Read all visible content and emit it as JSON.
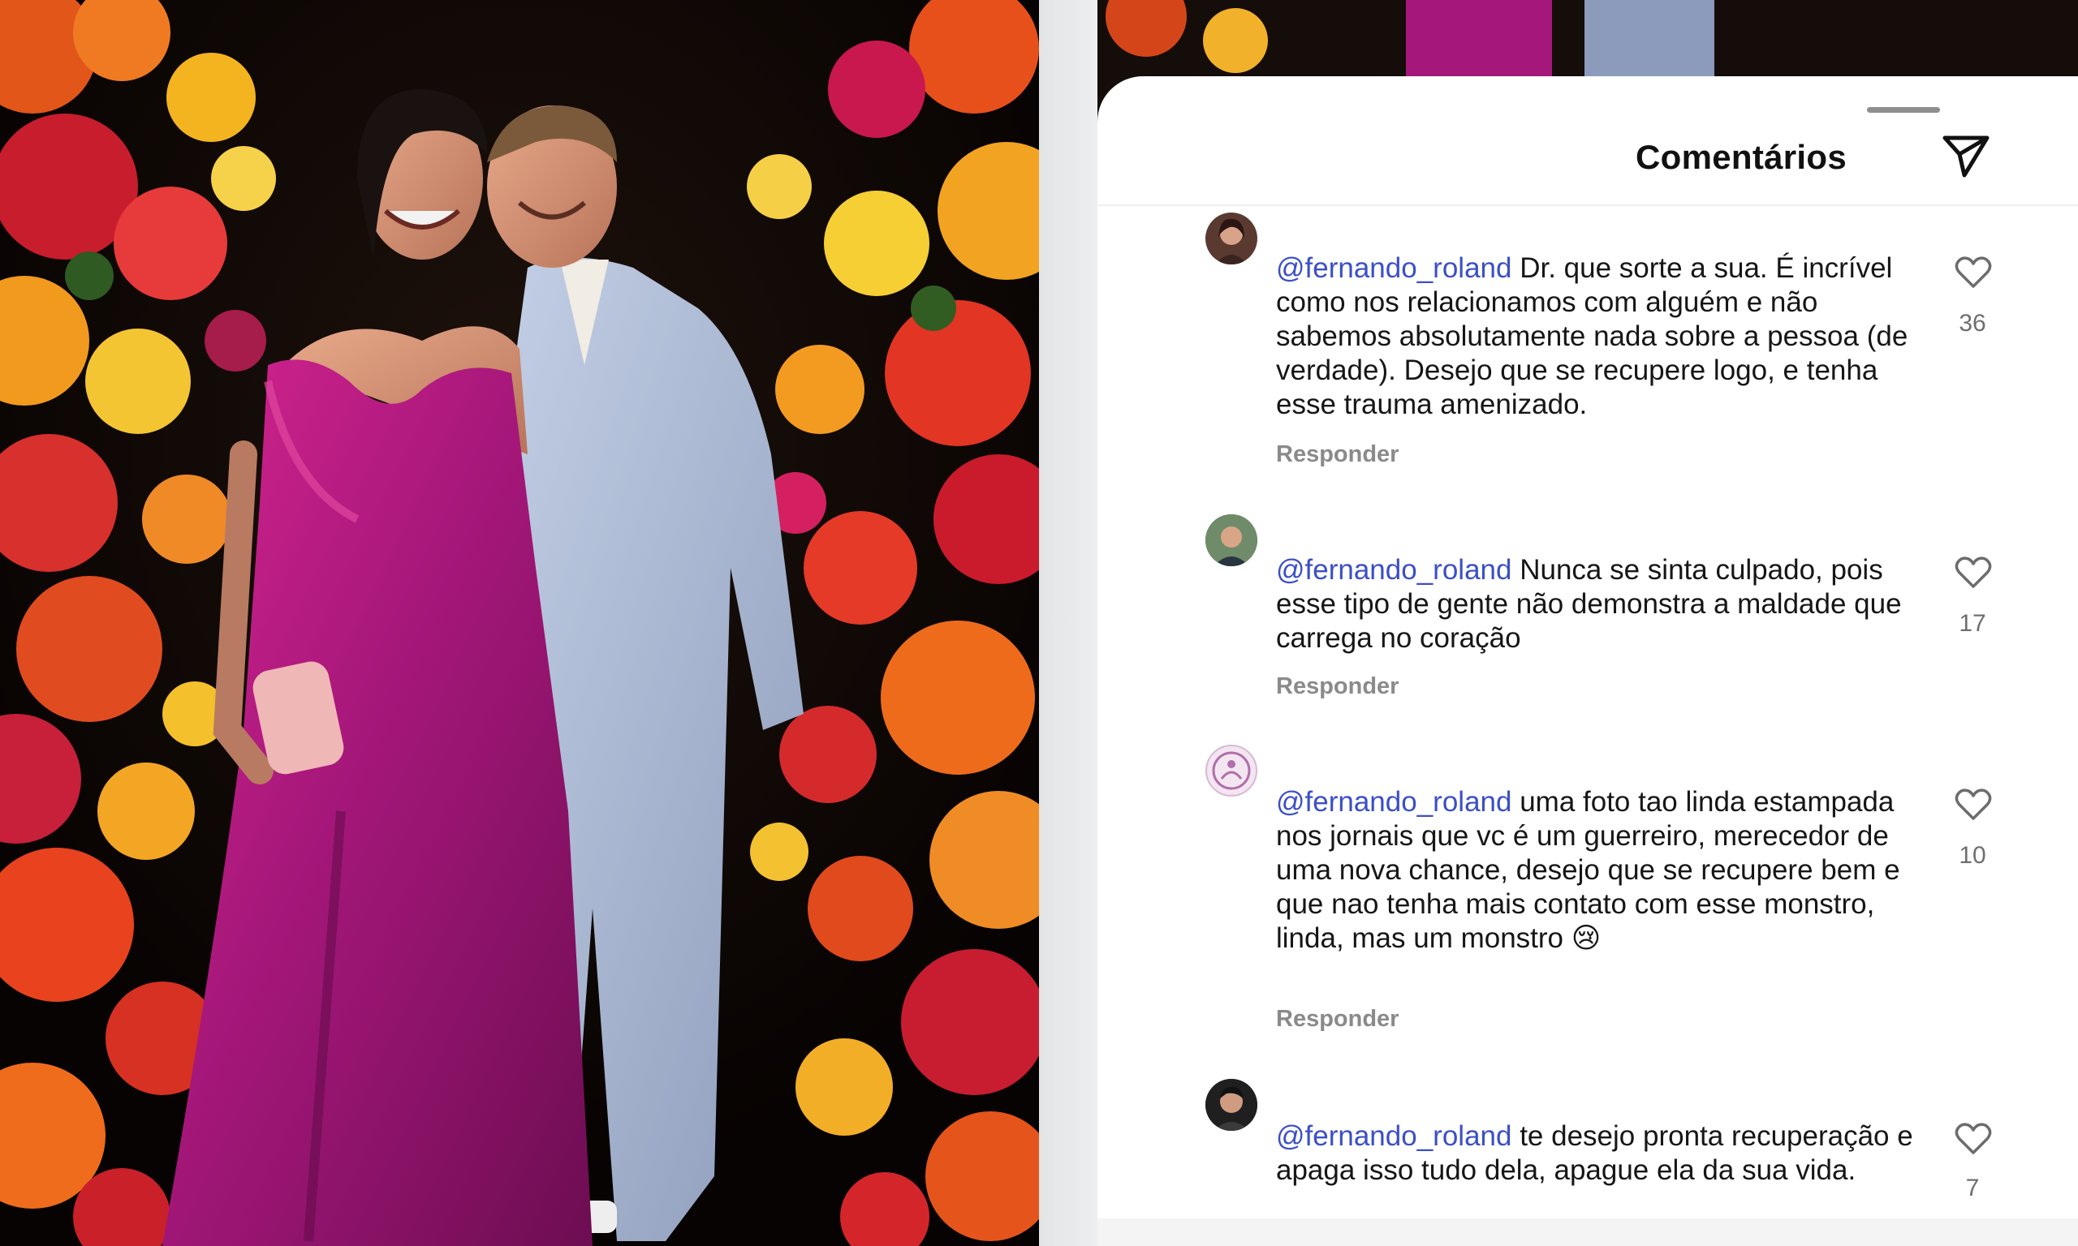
{
  "sheet": {
    "title": "Comentários",
    "share_icon": "paper-plane-icon"
  },
  "comments": [
    {
      "mention": "@fernando_roland",
      "text": "Dr. que sorte a sua. É incrível como nos relacionamos com alguém e não sabemos absolutamente nada sobre a pessoa (de verdade). Desejo que se recupere logo, e tenha esse trauma amenizado.",
      "reply_label": "Responder",
      "likes": "36",
      "avatar_color": "#5a3a30"
    },
    {
      "mention": "@fernando_roland",
      "text": "Nunca se sinta culpado, pois esse tipo de gente não demonstra a maldade que carrega no coração",
      "reply_label": "Responder",
      "likes": "17",
      "avatar_color": "#4d6a52"
    },
    {
      "mention": "@fernando_roland",
      "text": "uma foto tao linda estampada nos jornais que vc é um guerreiro, merecedor de uma nova chance, desejo que se recupere bem e que nao tenha mais contato com esse monstro, linda, mas um monstro 😢",
      "reply_label": "Responder",
      "likes": "10",
      "avatar_color": "#d9b8d6"
    },
    {
      "mention": "@fernando_roland",
      "text": "te desejo pronta recuperação e apaga isso tudo dela, apague ela da sua vida.",
      "reply_label": "",
      "likes": "7",
      "avatar_color": "#2b2b2b"
    }
  ],
  "colors": {
    "mention": "#3b4fc7",
    "dress": "#a8197c",
    "suit": "#a9b8d4"
  },
  "icons": [
    "heart-icon",
    "paper-plane-icon"
  ]
}
